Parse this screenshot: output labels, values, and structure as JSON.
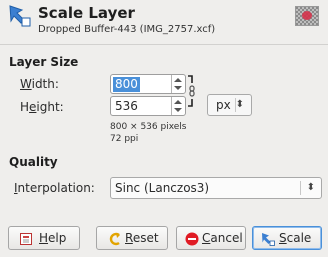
{
  "header": {
    "title": "Scale Layer",
    "subtitle": "Dropped Buffer-443 (IMG_2757.xcf)",
    "icon": "scale-layer-icon",
    "thumbnail_icon": "layer-thumbnail"
  },
  "layer_size": {
    "section_label": "Layer Size",
    "width_label_u": "W",
    "width_label_rest": "idth:",
    "width_value": "800",
    "height_label_pre": "H",
    "height_label_u": "e",
    "height_label_rest": "ight:",
    "height_value": "536",
    "unit": "px",
    "chain_icon": "chain-link-icon",
    "pixels_info": "800 × 536 pixels",
    "ppi_info": "72 ppi"
  },
  "quality": {
    "section_label": "Quality",
    "interpolation_label_u": "I",
    "interpolation_label_rest": "nterpolation:",
    "interpolation_value": "Sinc (Lanczos3)"
  },
  "buttons": {
    "help_u": "H",
    "help_rest": "elp",
    "reset_u": "R",
    "reset_rest": "eset",
    "cancel_u": "C",
    "cancel_rest": "ancel",
    "scale_u": "S",
    "scale_rest": "cale"
  },
  "colors": {
    "accent": "#4a90d9",
    "cancel_red": "#e01b24",
    "background": "#efeeec"
  }
}
